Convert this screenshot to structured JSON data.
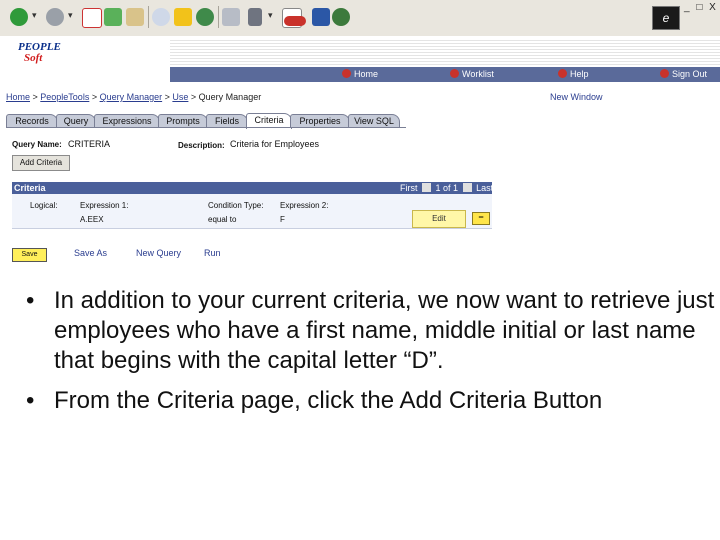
{
  "browser": {
    "throbber_label": "e",
    "window_controls": "_ □ X",
    "icons": [
      "back-arrow-icon",
      "forward-arrow-icon",
      "stop-icon",
      "refresh-icon",
      "home-icon",
      "search-icon",
      "favorites-icon",
      "history-icon",
      "print-icon",
      "edit-icon",
      "go-icon",
      "translate-icon",
      "messenger-icon"
    ]
  },
  "logo": {
    "line1": "PEOPLE",
    "line2": "Soft"
  },
  "nav": {
    "home": "Home",
    "worklist": "Worklist",
    "help": "Help",
    "signout": "Sign Out"
  },
  "breadcrumb": {
    "home": "Home",
    "peopletools": "PeopleTools",
    "query_manager": "Query Manager",
    "use": "Use",
    "current": "Query Manager",
    "sep": " > "
  },
  "new_window": "New Window",
  "tabs": [
    "Records",
    "Query",
    "Expressions",
    "Prompts",
    "Fields",
    "Criteria",
    "Properties",
    "View SQL"
  ],
  "active_tab": "Criteria",
  "query_name_label": "Query Name:",
  "query_name_value": "CRITERIA",
  "description_label": "Description:",
  "description_value": "Criteria for Employees",
  "add_criteria_label": "Add Criteria",
  "criteria": {
    "title": "Criteria",
    "nav_first": "First",
    "nav_range": "1 of 1",
    "nav_last": "Last",
    "headers": {
      "logical": "Logical:",
      "expr1": "Expression 1:",
      "condition": "Condition Type:",
      "expr2": "Expression 2:"
    },
    "row": {
      "logical": "",
      "expr1": "A.EEX",
      "condition": "equal to",
      "expr2": "F"
    },
    "edit_label": "Edit",
    "delete_label": "−"
  },
  "actions": {
    "save": "Save",
    "save_as": "Save As",
    "new_query": "New Query",
    "run": "Run"
  },
  "bullets": [
    "In addition to your current criteria, we now want to retrieve just employees who have a first name, middle initial or last name that begins with the capital letter “D”.",
    "From the Criteria page, click the Add Criteria Button"
  ],
  "bullet_symbol": "•"
}
